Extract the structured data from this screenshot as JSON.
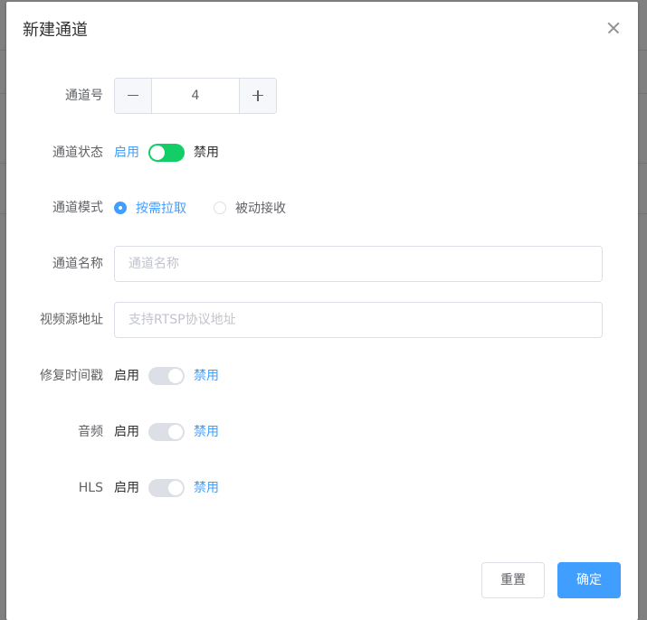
{
  "dialog": {
    "title": "新建通道",
    "close_icon": "close-icon"
  },
  "channel_number": {
    "label": "通道号",
    "value": "4",
    "minus_icon": "minus-icon",
    "plus_icon": "plus-icon"
  },
  "channel_status": {
    "label": "通道状态",
    "on_text": "启用",
    "off_text": "禁用",
    "enabled": true
  },
  "channel_mode": {
    "label": "通道模式",
    "options": [
      "按需拉取",
      "被动接收"
    ],
    "selected": "按需拉取"
  },
  "channel_name": {
    "label": "通道名称",
    "value": "",
    "placeholder": "通道名称"
  },
  "video_source": {
    "label": "视频源地址",
    "value": "",
    "placeholder": "支持RTSP协议地址"
  },
  "fix_timestamp": {
    "label": "修复时间戳",
    "on_text": "启用",
    "off_text": "禁用",
    "enabled": false
  },
  "audio": {
    "label": "音频",
    "on_text": "启用",
    "off_text": "禁用",
    "enabled": false
  },
  "hls": {
    "label": "HLS",
    "on_text": "启用",
    "off_text": "禁用",
    "enabled": false
  },
  "footer": {
    "reset_label": "重置",
    "confirm_label": "确定"
  },
  "colors": {
    "primary": "#409eff",
    "switch_on": "#13ce66",
    "switch_off": "#dcdfe6",
    "overlay": "#808080"
  }
}
